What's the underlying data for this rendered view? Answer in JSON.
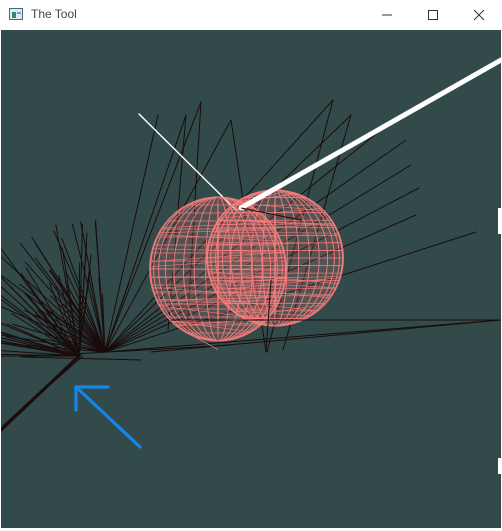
{
  "window": {
    "title": "The Tool",
    "controls": {
      "minimize_icon": "minimize-icon",
      "maximize_icon": "maximize-icon",
      "close_icon": "close-icon"
    }
  },
  "scene": {
    "background_color": "#324a4a",
    "sphere_color": "#ff7f7f",
    "tree_color": "#1a0c0c",
    "arrow_color": "#1486e6",
    "beam_color": "#ffffff"
  }
}
